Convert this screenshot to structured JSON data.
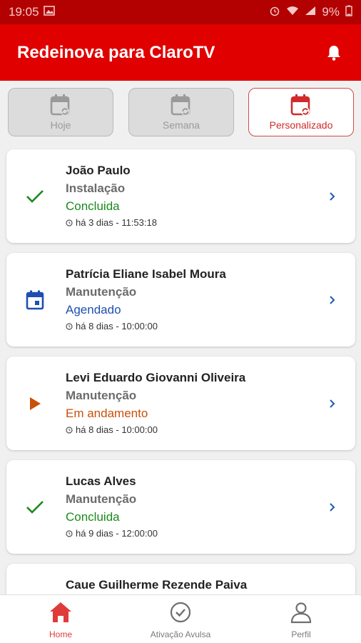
{
  "status_bar": {
    "time": "19:05",
    "battery": "9%"
  },
  "app": {
    "title": "Redeinova para ClaroTV"
  },
  "filters": [
    {
      "label": "Hoje",
      "active": false
    },
    {
      "label": "Semana",
      "active": false
    },
    {
      "label": "Personalizado",
      "active": true
    }
  ],
  "orders": [
    {
      "name": "João Paulo",
      "type": "Instalação",
      "status": "Concluida",
      "status_color": "#1a8a1a",
      "status_icon": "check-icon",
      "time": "há 3 dias - 11:53:18"
    },
    {
      "name": "Patrícia Eliane Isabel Moura",
      "type": "Manutenção",
      "status": "Agendado",
      "status_color": "#1e4fb0",
      "status_icon": "calendar-icon",
      "time": "há 8 dias - 10:00:00"
    },
    {
      "name": "Levi Eduardo Giovanni Oliveira",
      "type": "Manutenção",
      "status": "Em andamento",
      "status_color": "#c9500a",
      "status_icon": "play-icon",
      "time": "há 8 dias - 10:00:00"
    },
    {
      "name": "Lucas Alves",
      "type": "Manutenção",
      "status": "Concluida",
      "status_color": "#1a8a1a",
      "status_icon": "check-icon",
      "time": "há 9 dias - 12:00:00"
    },
    {
      "name": "Caue Guilherme Rezende Paiva"
    }
  ],
  "bottom_nav": [
    {
      "label": "Home",
      "icon": "home-icon",
      "active": true
    },
    {
      "label": "Ativação Avulsa",
      "icon": "check-circle-icon",
      "active": false
    },
    {
      "label": "Perfil",
      "icon": "user-icon",
      "active": false
    }
  ],
  "colors": {
    "primary": "#e00000",
    "status_bar": "#b30000",
    "active_tab": "#e03b3b"
  }
}
